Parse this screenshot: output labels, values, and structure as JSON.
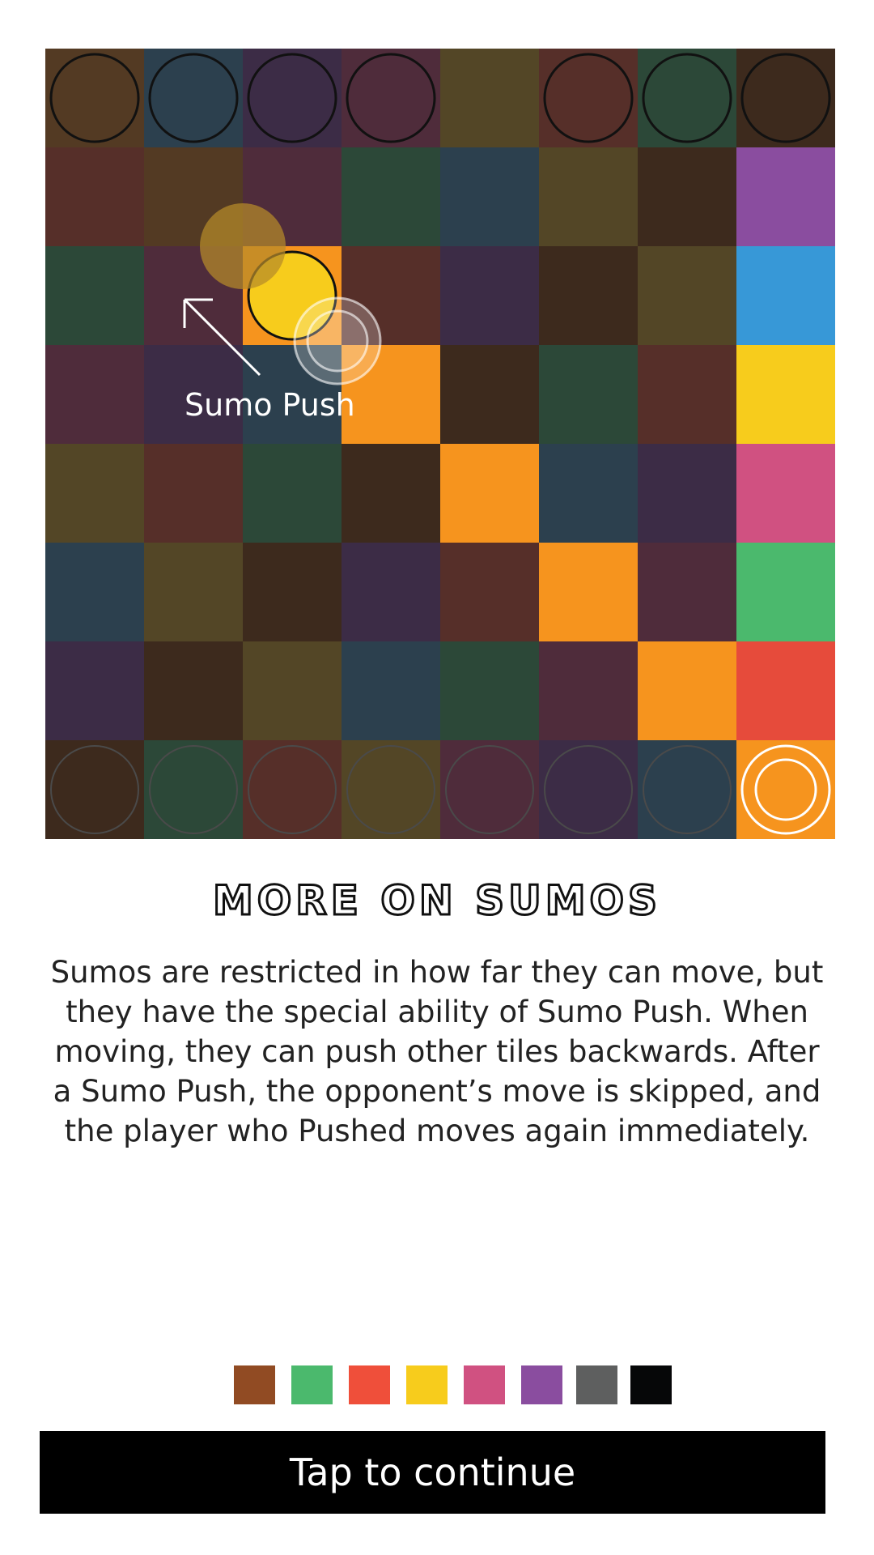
{
  "board": {
    "rows": [
      [
        "#533a23",
        "#2c404e",
        "#3c2c46",
        "#4f2c3b",
        "#534626",
        "#562f29",
        "#2c4838",
        "#3d2a1d"
      ],
      [
        "#562f29",
        "#533a23",
        "#4f2c3b",
        "#2c4838",
        "#2c404e",
        "#534626",
        "#3d2a1d",
        "#8a4d9f"
      ],
      [
        "#2c4838",
        "#4f2c3b",
        "#f6941e",
        "#562f29",
        "#3c2c46",
        "#3d2a1d",
        "#534626",
        "#3798d7"
      ],
      [
        "#4f2c3b",
        "#3c2c46",
        "#2c404e",
        "#f6941e",
        "#3d2a1d",
        "#2c4838",
        "#562f29",
        "#f7cc1c"
      ],
      [
        "#534626",
        "#562f29",
        "#2c4838",
        "#3d2a1d",
        "#f6941e",
        "#2c404e",
        "#3c2c46",
        "#d05181"
      ],
      [
        "#2c404e",
        "#534626",
        "#3d2a1d",
        "#3c2c46",
        "#562f29",
        "#f6941e",
        "#4f2c3b",
        "#4bb96d"
      ],
      [
        "#3c2c46",
        "#3d2a1d",
        "#534626",
        "#2c404e",
        "#2c4838",
        "#4f2c3b",
        "#f6941e",
        "#e64b3b"
      ],
      [
        "#3d2a1d",
        "#2c4838",
        "#562f29",
        "#534626",
        "#4f2c3b",
        "#3c2c46",
        "#2c404e",
        "#f6941e"
      ]
    ],
    "top_pieces": [
      {
        "col": 0,
        "row": 0,
        "style": "dark"
      },
      {
        "col": 1,
        "row": 0,
        "style": "dark"
      },
      {
        "col": 2,
        "row": 0,
        "style": "dark"
      },
      {
        "col": 3,
        "row": 0,
        "style": "dark"
      },
      {
        "col": 5,
        "row": 0,
        "style": "dark"
      },
      {
        "col": 6,
        "row": 0,
        "style": "dark"
      },
      {
        "col": 7,
        "row": 0,
        "style": "dark"
      },
      {
        "col": 2,
        "row": 2,
        "style": "moving",
        "fill": "#f7cc1c"
      }
    ],
    "bottom_pieces": [
      {
        "col": 0,
        "row": 7,
        "style": "faint"
      },
      {
        "col": 1,
        "row": 7,
        "style": "faint"
      },
      {
        "col": 2,
        "row": 7,
        "style": "faint"
      },
      {
        "col": 3,
        "row": 7,
        "style": "faint"
      },
      {
        "col": 4,
        "row": 7,
        "style": "faint"
      },
      {
        "col": 5,
        "row": 7,
        "style": "faint"
      },
      {
        "col": 6,
        "row": 7,
        "style": "faint"
      },
      {
        "col": 7,
        "row": 7,
        "style": "sumo"
      }
    ]
  },
  "tutorial": {
    "arrow_label": "Sumo Push",
    "title": "MORE ON SUMOS",
    "body": "Sumos are restricted in how far they can move, but they have the special ability of Sumo Push. When moving, they can push other tiles backwards. After a Sumo Push, the opponent’s move is skipped, and the player who Pushed moves again immediately.",
    "continue_label": "Tap to continue"
  },
  "palette": [
    "#914b23",
    "#4bb96d",
    "#ef4f3a",
    "#f7cc1c",
    "#d05181",
    "#8a4d9f",
    "#5e5f5f",
    "#060708"
  ]
}
